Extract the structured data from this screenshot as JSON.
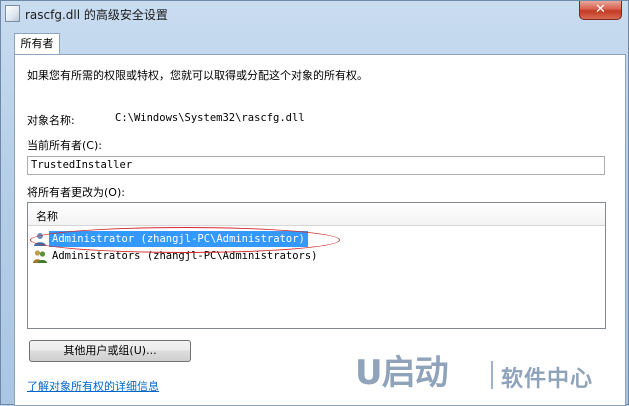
{
  "window": {
    "title": "rascfg.dll 的高级安全设置",
    "close_glyph": "✕"
  },
  "tabs": [
    {
      "label": "所有者"
    }
  ],
  "owner_tab": {
    "intro": "如果您有所需的权限或特权，您就可以取得或分配这个对象的所有权。",
    "object_name_label": "对象名称:",
    "object_name_value": "C:\\Windows\\System32\\rascfg.dll",
    "current_owner_label": "当前所有者(C):",
    "current_owner_value": "TrustedInstaller",
    "change_owner_label": "将所有者更改为(O):",
    "list": {
      "column_header": "名称",
      "rows": [
        {
          "label": "Administrator (zhangjl-PC\\Administrator)",
          "icon": "user-icon",
          "selected": true
        },
        {
          "label": "Administrators (zhangjl-PC\\Administrators)",
          "icon": "users-group-icon",
          "selected": false
        }
      ]
    },
    "other_users_button": "其他用户或组(U)...",
    "learn_more_link": "了解对象所有权的详细信息"
  },
  "watermark": {
    "logo": "U启动",
    "text": "软件中心"
  },
  "colors": {
    "selection": "#3399ff",
    "annotation_circle": "#d12a2a",
    "link": "#0066cc"
  }
}
